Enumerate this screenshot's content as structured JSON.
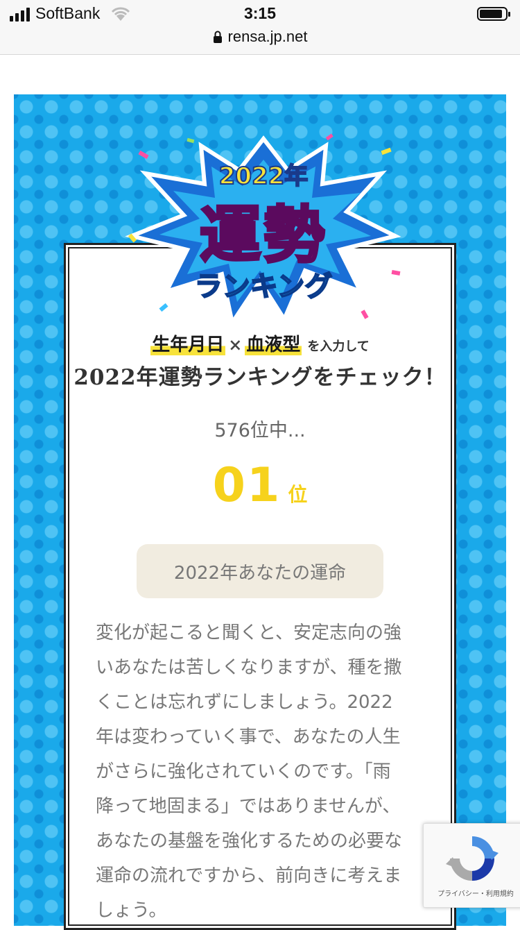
{
  "status_bar": {
    "carrier": "SoftBank",
    "time": "3:15",
    "url": "rensa.jp.net"
  },
  "logo": {
    "year": "2022年",
    "title": "運勢",
    "subtitle": "ランキング"
  },
  "intro": {
    "birthdate": "生年月日",
    "times": "×",
    "blood_type": "血液型",
    "suffix": "を入力して"
  },
  "headline": "2022年運勢ランキングをチェック！",
  "rank": {
    "total_text": "576位中...",
    "number": "01",
    "suffix": "位"
  },
  "fate_title": "2022年あなたの運命",
  "body_text": "変化が起こると聞くと、安定志向の強\nいあなたは苦しくなりますが、種を撒\nくことは忘れずにしましょう。2022\n年は変わっていく事で、あなたの人生\nがさらに強化されていくのです。「雨\n降って地固まる」ではありませんが、\nあなたの基盤を強化するための必要な\n運命の流れですから、前向きに考えま\nしょう。",
  "recaptcha": {
    "links": "プライバシー・利用規約"
  },
  "colors": {
    "pattern_blue": "#1aa9ea",
    "rank_yellow": "#f6d21c",
    "logo_pink": "#ff2ea0",
    "fate_box_bg": "#f1ece0"
  }
}
